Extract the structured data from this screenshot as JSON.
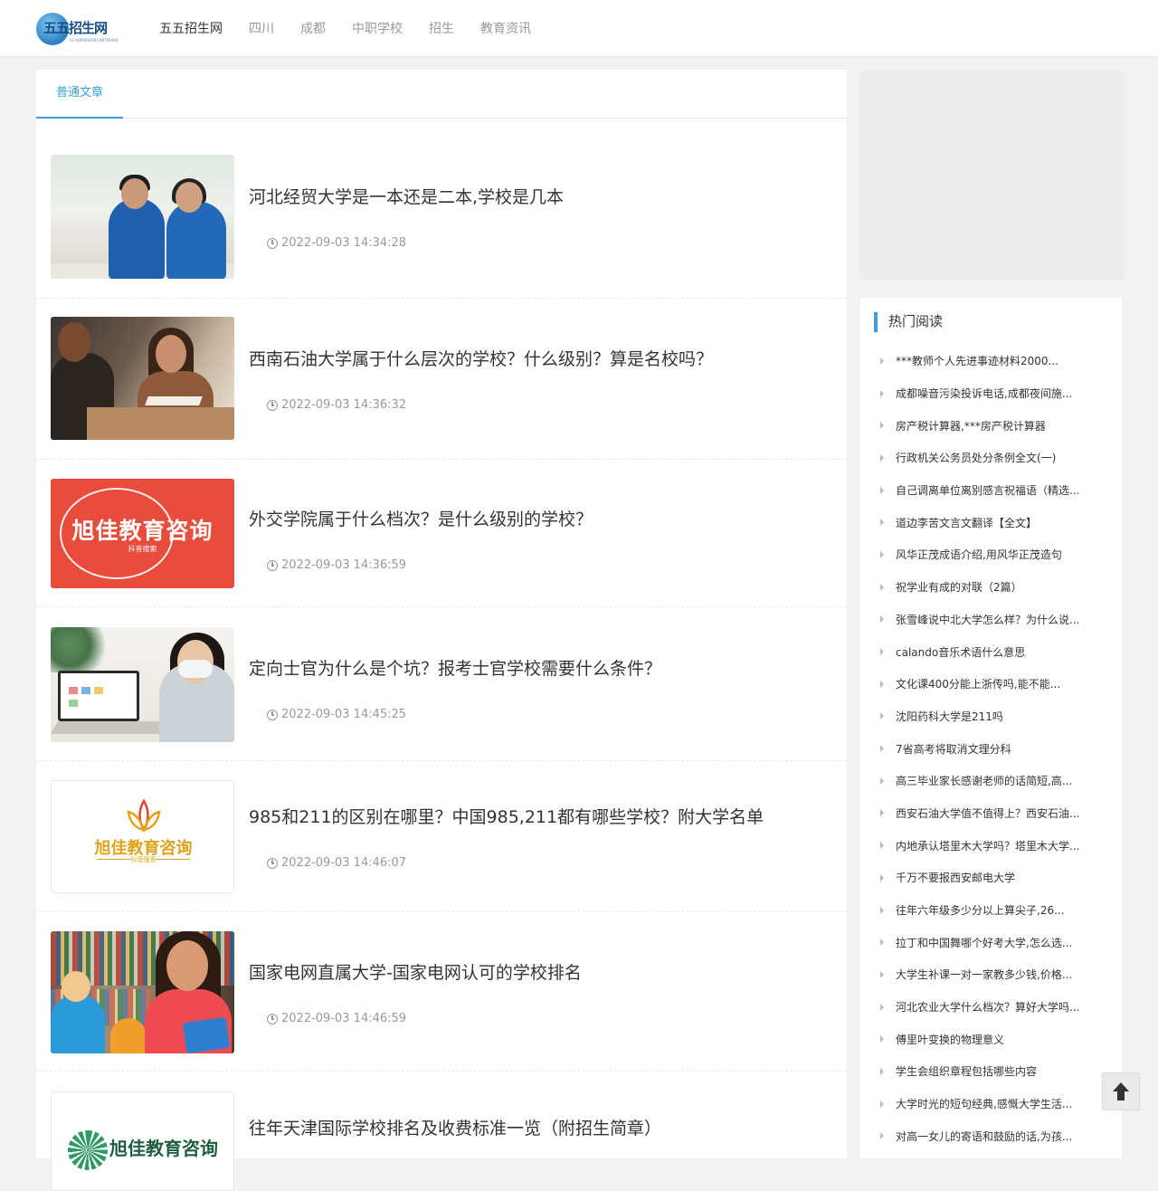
{
  "brand": {
    "name": "五五招生网",
    "sub": "55 ADMISSIONS NETWORK"
  },
  "nav": [
    {
      "label": "五五招生网",
      "active": true
    },
    {
      "label": "四川",
      "active": false
    },
    {
      "label": "成都",
      "active": false
    },
    {
      "label": "中职学校",
      "active": false
    },
    {
      "label": "招生",
      "active": false
    },
    {
      "label": "教育资讯",
      "active": false
    }
  ],
  "tabs": {
    "active_label": "普通文章"
  },
  "articles": [
    {
      "title": "河北经贸大学是一本还是二本,学校是几本",
      "time": "2022-09-03 14:34:28",
      "thumb": "students-photo"
    },
    {
      "title": "西南石油大学属于什么层次的学校？什么级别？算是名校吗？",
      "time": "2022-09-03 14:36:32",
      "thumb": "reading-photo"
    },
    {
      "title": "外交学院属于什么档次？是什么级别的学校？",
      "time": "2022-09-03 14:36:59",
      "thumb": "xujia-red-logo",
      "thumb_text": "旭佳教育咨询",
      "thumb_sub": "抖音搜索"
    },
    {
      "title": "定向士官为什么是个坑？报考士官学校需要什么条件？",
      "time": "2022-09-03 14:45:25",
      "thumb": "computer-girl-photo"
    },
    {
      "title": "985和211的区别在哪里？中国985,211都有哪些学校？附大学名单",
      "time": "2022-09-03 14:46:07",
      "thumb": "xujia-gold-logo",
      "thumb_text": "旭佳教育咨询",
      "thumb_sub": "抖音搜索"
    },
    {
      "title": "国家电网直属大学-国家电网认可的学校排名",
      "time": "2022-09-03 14:46:59",
      "thumb": "library-photo"
    },
    {
      "title": "往年天津国际学校排名及收费标准一览（附招生简章）",
      "time": "",
      "thumb": "xujia-green-logo",
      "thumb_text": "旭佳教育咨询"
    }
  ],
  "sidebar": {
    "title": "热门阅读",
    "items": [
      "***教师个人先进事迹材料2000...",
      "成都噪音污染投诉电话,成都夜间施...",
      "房产税计算器,***房产税计算器",
      "行政机关公务员处分条例全文(一)",
      "自己调离单位离别感言祝福语（精选...",
      "道边李苦文言文翻译【全文】",
      "风华正茂成语介绍,用风华正茂造句",
      "祝学业有成的对联（2篇）",
      "张雪峰说中北大学怎么样？为什么说...",
      "calando音乐术语什么意思",
      "文化课400分能上浙传吗,能不能...",
      "沈阳药科大学是211吗",
      "7省高考将取消文理分科",
      "高三毕业家长感谢老师的话简短,高...",
      "西安石油大学值不值得上？西安石油...",
      "内地承认塔里木大学吗？塔里木大学...",
      "千万不要报西安邮电大学",
      "往年六年级多少分以上算尖子,26...",
      "拉丁和中国舞哪个好考大学,怎么选...",
      "大学生补课一对一家教多少钱,价格...",
      "河北农业大学什么档次？算好大学吗...",
      "傅里叶变换的物理意义",
      "学生会组织章程包括哪些内容",
      "大学时光的短句经典,感慨大学生活...",
      "对高一女儿的寄语和鼓励的话,为孩..."
    ]
  },
  "colors": {
    "accent": "#3b9fd6",
    "logo_red": "#e74c3c",
    "logo_gold": "#e0a21b"
  }
}
